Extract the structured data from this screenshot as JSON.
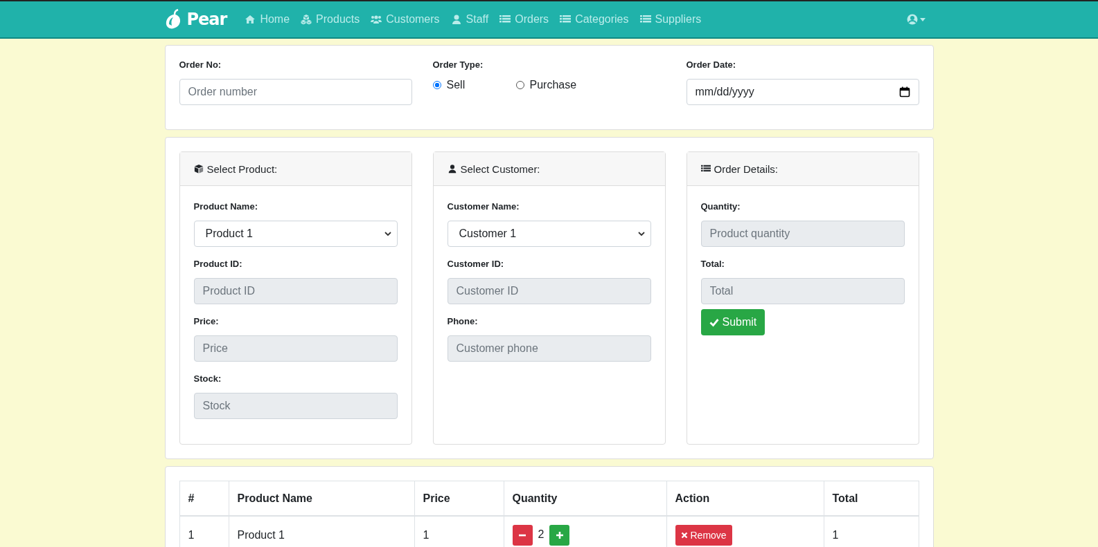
{
  "navbar": {
    "brand": "Pear",
    "links": [
      {
        "label": "Home",
        "kind": "home"
      },
      {
        "label": "Products",
        "kind": "cubes"
      },
      {
        "label": "Customers",
        "kind": "users"
      },
      {
        "label": "Staff",
        "kind": "user"
      },
      {
        "label": "Orders",
        "kind": "list"
      },
      {
        "label": "Categories",
        "kind": "list"
      },
      {
        "label": "Suppliers",
        "kind": "list"
      }
    ]
  },
  "order_header": {
    "order_no": {
      "label": "Order No:",
      "placeholder": "Order number"
    },
    "order_type": {
      "label": "Order Type:",
      "options": [
        {
          "label": "Sell",
          "selected": true
        },
        {
          "label": "Purchase",
          "selected": false
        }
      ]
    },
    "order_date": {
      "label": "Order Date:",
      "value": "mm/dd/yyyy"
    }
  },
  "panels": [
    {
      "title": "Select Product:",
      "kind": "cube",
      "fields": [
        {
          "kind": "select",
          "label": "Product Name:",
          "value": "Product 1",
          "disabled": false
        },
        {
          "kind": "input",
          "label": "Product ID:",
          "placeholder": "Product ID",
          "disabled": true
        },
        {
          "kind": "input",
          "label": "Price:",
          "placeholder": "Price",
          "disabled": true
        },
        {
          "kind": "input",
          "label": "Stock:",
          "placeholder": "Stock",
          "disabled": true
        }
      ]
    },
    {
      "title": "Select Customer:",
      "kind": "user",
      "fields": [
        {
          "kind": "select",
          "label": "Customer Name:",
          "value": "Customer 1",
          "disabled": false
        },
        {
          "kind": "input",
          "label": "Customer ID:",
          "placeholder": "Customer ID",
          "disabled": true
        },
        {
          "kind": "input",
          "label": "Phone:",
          "placeholder": "Customer phone",
          "disabled": true
        }
      ]
    },
    {
      "title": "Order Details:",
      "kind": "list",
      "fields": [
        {
          "kind": "input",
          "label": "Quantity:",
          "placeholder": "Product quantity",
          "disabled": true
        },
        {
          "kind": "input",
          "label": "Total:",
          "placeholder": "Total",
          "disabled": true
        }
      ],
      "button": "Submit"
    }
  ],
  "table": {
    "columns": [
      "#",
      "Product Name",
      "Price",
      "Quantity",
      "Action",
      "Total"
    ],
    "rows": [
      {
        "number": "1",
        "product": "Product 1",
        "price": "1",
        "quantity": "2",
        "action": "Remove",
        "total": "1"
      }
    ]
  }
}
